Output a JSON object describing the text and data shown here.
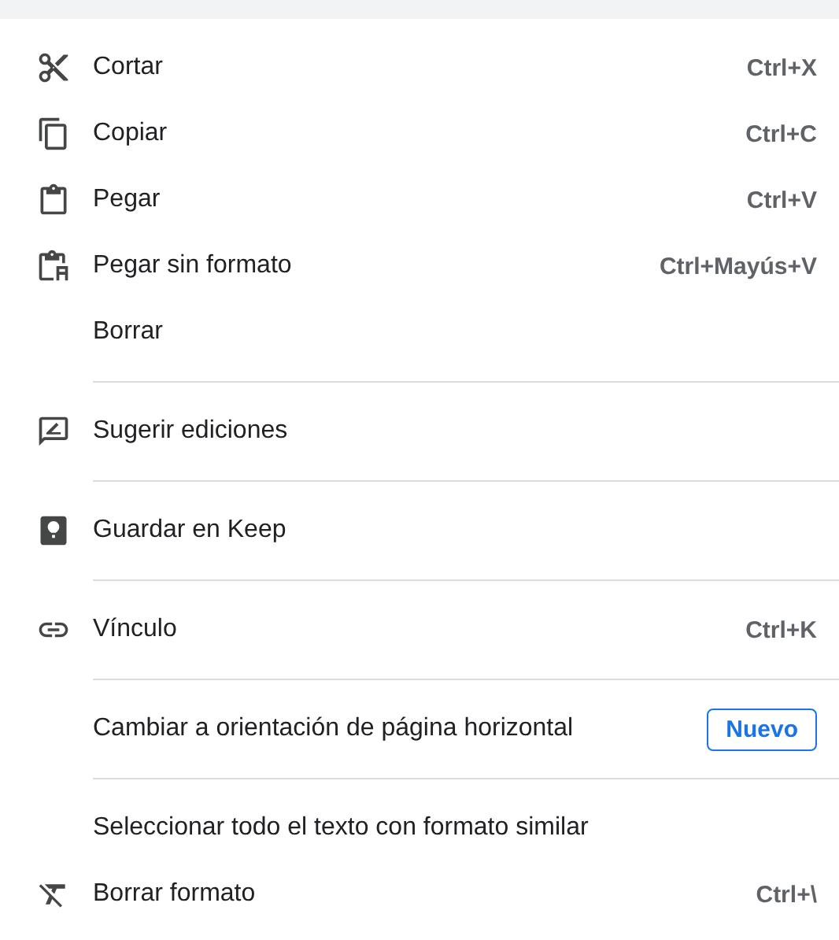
{
  "sections": [
    {
      "items": [
        {
          "kind": "scissors",
          "label": "Cortar",
          "shortcut": "Ctrl+X"
        },
        {
          "kind": "copy",
          "label": "Copiar",
          "shortcut": "Ctrl+C"
        },
        {
          "kind": "clipboard",
          "label": "Pegar",
          "shortcut": "Ctrl+V"
        },
        {
          "kind": "clipboardtext",
          "label": "Pegar sin formato",
          "shortcut": "Ctrl+Mayús+V"
        },
        {
          "label": "Borrar"
        }
      ]
    },
    {
      "items": [
        {
          "kind": "suggest",
          "label": "Sugerir ediciones"
        }
      ]
    },
    {
      "items": [
        {
          "kind": "keep",
          "label": "Guardar en Keep"
        }
      ]
    },
    {
      "items": [
        {
          "kind": "link",
          "label": "Vínculo",
          "shortcut": "Ctrl+K"
        }
      ]
    },
    {
      "items": [
        {
          "label": "Cambiar a orientación de página horizontal",
          "badge": "Nuevo"
        }
      ]
    },
    {
      "items": [
        {
          "label": "Seleccionar todo el texto con formato similar"
        },
        {
          "kind": "unformat",
          "label": "Borrar formato",
          "shortcut": "Ctrl+\\"
        }
      ]
    }
  ]
}
